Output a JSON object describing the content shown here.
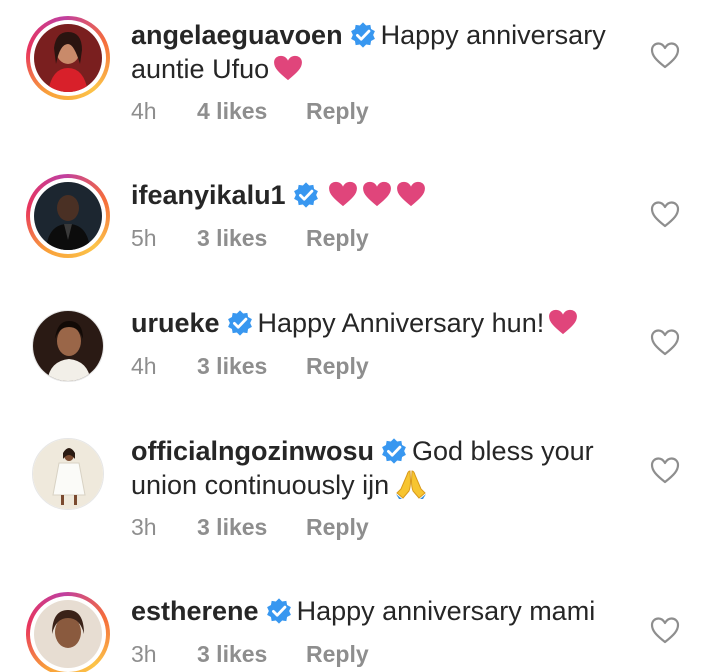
{
  "comments": [
    {
      "username": "angelaeguavoen",
      "text_line1": "Happy anniversary",
      "text_line2": "auntie Ufuo",
      "emoji": "heart",
      "time": "4h",
      "likes": "4 likes",
      "reply": "Reply",
      "story_ring": true
    },
    {
      "username": "ifeanyikalu1",
      "text_line1": "",
      "emoji": "heart heart heart",
      "time": "5h",
      "likes": "3 likes",
      "reply": "Reply",
      "story_ring": true
    },
    {
      "username": "urueke",
      "text_line1": "Happy Anniversary hun!",
      "emoji": "heart",
      "time": "4h",
      "likes": "3 likes",
      "reply": "Reply",
      "story_ring": false
    },
    {
      "username": "officialngozinwosu",
      "text_line1": "God bless your",
      "text_line2": "union continuously ijn",
      "emoji": "folded-hands",
      "time": "3h",
      "likes": "3 likes",
      "reply": "Reply",
      "story_ring": false
    },
    {
      "username": "estherene",
      "text_line1": "Happy anniversary mami",
      "time": "3h",
      "likes": "3 likes",
      "reply": "Reply",
      "story_ring": true
    }
  ],
  "colors": {
    "verified_blue": "#3897f0",
    "heart_pink": "#e0457b",
    "meta_gray": "#8e8e8e"
  },
  "icons": {
    "verified": "verified-badge-icon",
    "like": "heart-outline-icon"
  }
}
